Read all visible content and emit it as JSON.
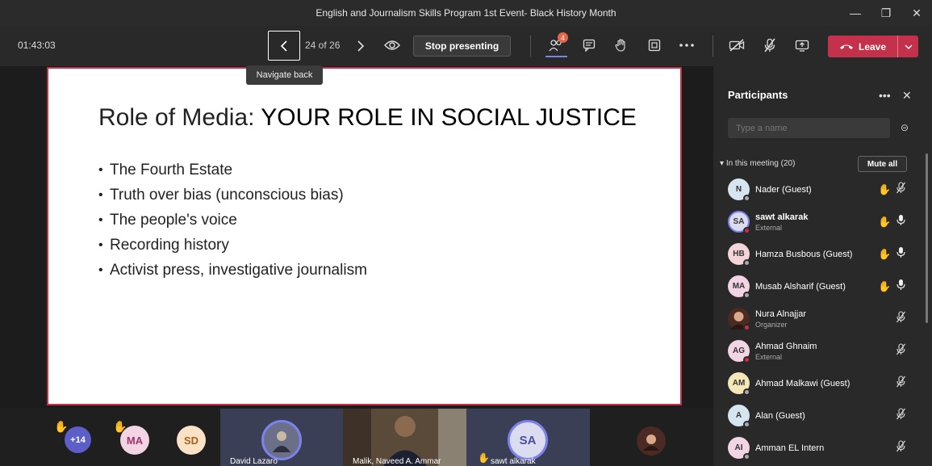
{
  "window": {
    "title": "English and Journalism Skills Program 1st Event- Black History Month",
    "minimize": "—",
    "maximize": "❐",
    "close": "✕"
  },
  "toolbar": {
    "timer": "01:43:03",
    "page_count": "24 of 26",
    "stop_presenting": "Stop presenting",
    "participants_badge": "4",
    "leave": "Leave",
    "tooltip": "Navigate back"
  },
  "slide": {
    "title_regular": "Role of Media: ",
    "title_bold": "YOUR ROLE IN SOCIAL JUSTICE",
    "bullets": [
      "The Fourth Estate",
      "Truth over bias (unconscious bias)",
      "The people's voice",
      "Recording history",
      "Activist press, investigative journalism"
    ]
  },
  "strip": {
    "overflow": "+14",
    "avatar1": "MA",
    "avatar2": "SD",
    "tiles": [
      {
        "name": "David Lazaro"
      },
      {
        "name": "Malik, Naveed A. Ammar"
      },
      {
        "name": "sawt alkarak",
        "initials": "SA"
      }
    ]
  },
  "panel": {
    "title": "Participants",
    "search_placeholder": "Type a name",
    "section": "In this meeting (20)",
    "mute_all": "Mute all",
    "participants": [
      {
        "initials": "N",
        "name": "Nader (Guest)",
        "sub": "",
        "hand": true,
        "mic": "muted",
        "color": "#d5e6f0"
      },
      {
        "initials": "SA",
        "name": "sawt alkarak",
        "sub": "External",
        "hand": true,
        "mic": "on",
        "color": "#dcdcf0"
      },
      {
        "initials": "HB",
        "name": "Hamza Busbous (Guest)",
        "sub": "",
        "hand": true,
        "mic": "on",
        "color": "#f3d4d8"
      },
      {
        "initials": "MA",
        "name": "Musab Alsharif (Guest)",
        "sub": "",
        "hand": true,
        "mic": "on",
        "color": "#f3d4e4"
      },
      {
        "initials": "",
        "name": "Nura Alnajjar",
        "sub": "Organizer",
        "hand": false,
        "mic": "muted",
        "color": "#4a2a22"
      },
      {
        "initials": "AG",
        "name": "Ahmad Ghnaim",
        "sub": "External",
        "hand": false,
        "mic": "muted",
        "color": "#f3d4e4"
      },
      {
        "initials": "AM",
        "name": "Ahmad Malkawi (Guest)",
        "sub": "",
        "hand": false,
        "mic": "muted",
        "color": "#f6e7b8"
      },
      {
        "initials": "A",
        "name": "Alan (Guest)",
        "sub": "",
        "hand": false,
        "mic": "muted",
        "color": "#d5e6f0"
      },
      {
        "initials": "AI",
        "name": "Amman EL Intern",
        "sub": "",
        "hand": false,
        "mic": "muted",
        "color": "#f3d4e4"
      }
    ]
  }
}
